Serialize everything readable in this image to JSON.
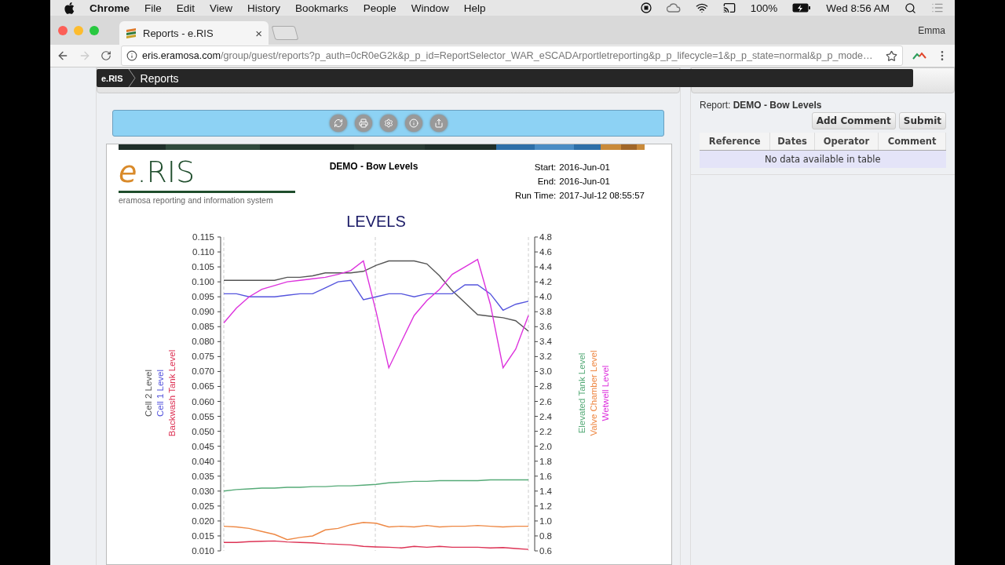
{
  "menu_bar": {
    "app": "Chrome",
    "menus": [
      "File",
      "Edit",
      "View",
      "History",
      "Bookmarks",
      "People",
      "Window",
      "Help"
    ],
    "battery": "100%",
    "clock": "Wed 8:56 AM"
  },
  "browser": {
    "tabs": [
      {
        "title": "Reports - e.RIS",
        "close": "×",
        "selected": true
      }
    ],
    "profile": "Emma",
    "address": {
      "host": "eris.eramosa.com",
      "path": "/group/guest/reports?p_auth=0cR0eG2k&p_p_id=ReportSelector_WAR_eSCADArportletreporting&p_p_lifecycle=1&p_p_state=normal&p_p_mode…"
    },
    "forward_disabled": true
  },
  "nav_bar": {
    "brand": "e.RIS",
    "crumb": "Reports"
  },
  "report_panel": {
    "logo": {
      "mark": "e",
      "name": ".RIS",
      "tagline": "eramosa reporting and information system"
    },
    "title": "DEMO - Bow Levels",
    "meta": [
      {
        "label": "Start:",
        "value": "2016-Jun-01"
      },
      {
        "label": "End:",
        "value": "2016-Jun-01"
      },
      {
        "label": "Run Time:",
        "value": "2017-Jul-12 08:55:57"
      }
    ],
    "chart_data": {
      "type": "line",
      "title": "LEVELS",
      "grid": true,
      "ylim": [
        0.01,
        0.115
      ],
      "y2lim": [
        0.6,
        4.8
      ],
      "yticks": [
        {
          "value": 0.115,
          "label": "0.115"
        },
        {
          "value": 0.11,
          "label": "0.110"
        },
        {
          "value": 0.105,
          "label": "0.105"
        },
        {
          "value": 0.1,
          "label": "0.100"
        },
        {
          "value": 0.095,
          "label": "0.095"
        },
        {
          "value": 0.09,
          "label": "0.090"
        },
        {
          "value": 0.085,
          "label": "0.085"
        },
        {
          "value": 0.08,
          "label": "0.080"
        },
        {
          "value": 0.075,
          "label": "0.075"
        },
        {
          "value": 0.07,
          "label": "0.070"
        },
        {
          "value": 0.065,
          "label": "0.065"
        },
        {
          "value": 0.06,
          "label": "0.060"
        },
        {
          "value": 0.055,
          "label": "0.055"
        },
        {
          "value": 0.05,
          "label": "0.050"
        },
        {
          "value": 0.045,
          "label": "0.045"
        },
        {
          "value": 0.04,
          "label": "0.040"
        },
        {
          "value": 0.035,
          "label": "0.035"
        },
        {
          "value": 0.03,
          "label": "0.030"
        },
        {
          "value": 0.025,
          "label": "0.025"
        },
        {
          "value": 0.02,
          "label": "0.020"
        },
        {
          "value": 0.015,
          "label": "0.015"
        },
        {
          "value": 0.01,
          "label": "0.010"
        }
      ],
      "y2ticks": [
        {
          "value": 4.8,
          "label": "4.8"
        },
        {
          "value": 4.6,
          "label": "4.6"
        },
        {
          "value": 4.4,
          "label": "4.4"
        },
        {
          "value": 4.2,
          "label": "4.2"
        },
        {
          "value": 4.0,
          "label": "4.0"
        },
        {
          "value": 3.8,
          "label": "3.8"
        },
        {
          "value": 3.6,
          "label": "3.6"
        },
        {
          "value": 3.4,
          "label": "3.4"
        },
        {
          "value": 3.2,
          "label": "3.2"
        },
        {
          "value": 3.0,
          "label": "3.0"
        },
        {
          "value": 2.8,
          "label": "2.8"
        },
        {
          "value": 2.6,
          "label": "2.6"
        },
        {
          "value": 2.4,
          "label": "2.4"
        },
        {
          "value": 2.2,
          "label": "2.2"
        },
        {
          "value": 2.0,
          "label": "2.0"
        },
        {
          "value": 1.8,
          "label": "1.8"
        },
        {
          "value": 1.6,
          "label": "1.6"
        },
        {
          "value": 1.4,
          "label": "1.4"
        },
        {
          "value": 1.2,
          "label": "1.2"
        },
        {
          "value": 1.0,
          "label": "1.0"
        },
        {
          "value": 0.8,
          "label": "0.8"
        },
        {
          "value": 0.6,
          "label": "0.6"
        }
      ],
      "series": [
        {
          "name": "Cell 2 Level",
          "color": "#555555",
          "values": [
            0.1005,
            0.1005,
            0.1005,
            0.1005,
            0.1005,
            0.1015,
            0.1015,
            0.102,
            0.103,
            0.103,
            0.103,
            0.1035,
            0.1055,
            0.107,
            0.107,
            0.107,
            0.106,
            0.102,
            0.097,
            0.093,
            0.089,
            0.0885,
            0.088,
            0.087,
            0.0835
          ]
        },
        {
          "name": "Cell 1 Level",
          "color": "#5555dd",
          "values": [
            0.096,
            0.096,
            0.095,
            0.095,
            0.095,
            0.0955,
            0.096,
            0.096,
            0.098,
            0.1,
            0.1005,
            0.094,
            0.095,
            0.096,
            0.096,
            0.095,
            0.096,
            0.096,
            0.096,
            0.099,
            0.099,
            0.096,
            0.0905,
            0.0925,
            0.0935
          ]
        },
        {
          "name": "Backwash Tank Level",
          "color": "#dd3355",
          "values": [
            0.0128,
            0.0128,
            0.0131,
            0.0132,
            0.0133,
            0.013,
            0.0128,
            0.0127,
            0.0124,
            0.0122,
            0.012,
            0.0115,
            0.0113,
            0.0112,
            0.011,
            0.0115,
            0.0112,
            0.0115,
            0.0112,
            0.0112,
            0.0112,
            0.011,
            0.0111,
            0.0108,
            0.0105
          ]
        },
        {
          "name": "Elevated Tank Level",
          "color": "#55aa77",
          "axis": "y2",
          "values": [
            1.4,
            1.42,
            1.43,
            1.44,
            1.44,
            1.45,
            1.45,
            1.46,
            1.46,
            1.47,
            1.47,
            1.48,
            1.49,
            1.51,
            1.52,
            1.53,
            1.53,
            1.54,
            1.54,
            1.54,
            1.54,
            1.55,
            1.55,
            1.55,
            1.55
          ]
        },
        {
          "name": "Valve Chamber Level",
          "color": "#ee8844",
          "axis": "y2",
          "values": [
            0.93,
            0.92,
            0.9,
            0.86,
            0.82,
            0.75,
            0.78,
            0.8,
            0.88,
            0.9,
            0.95,
            0.98,
            0.97,
            0.92,
            0.93,
            0.92,
            0.94,
            0.92,
            0.93,
            0.93,
            0.94,
            0.93,
            0.92,
            0.93,
            0.93
          ]
        },
        {
          "name": "Wetwell Level",
          "color": "#dd33dd",
          "axis": "y2",
          "values": [
            3.65,
            3.85,
            4.0,
            4.1,
            4.15,
            4.2,
            4.22,
            4.24,
            4.26,
            4.3,
            4.35,
            4.48,
            3.8,
            3.05,
            3.4,
            3.75,
            3.95,
            4.1,
            4.3,
            4.4,
            4.5,
            3.9,
            3.05,
            3.3,
            3.75
          ]
        }
      ]
    }
  },
  "comments_panel": {
    "report_label": "Report:",
    "report_name": "DEMO - Bow Levels",
    "buttons": [
      "Add Comment",
      "Submit"
    ],
    "table": {
      "columns": [
        "Reference",
        "Dates",
        "Operator",
        "Comment"
      ],
      "empty": "No data available in table"
    }
  }
}
